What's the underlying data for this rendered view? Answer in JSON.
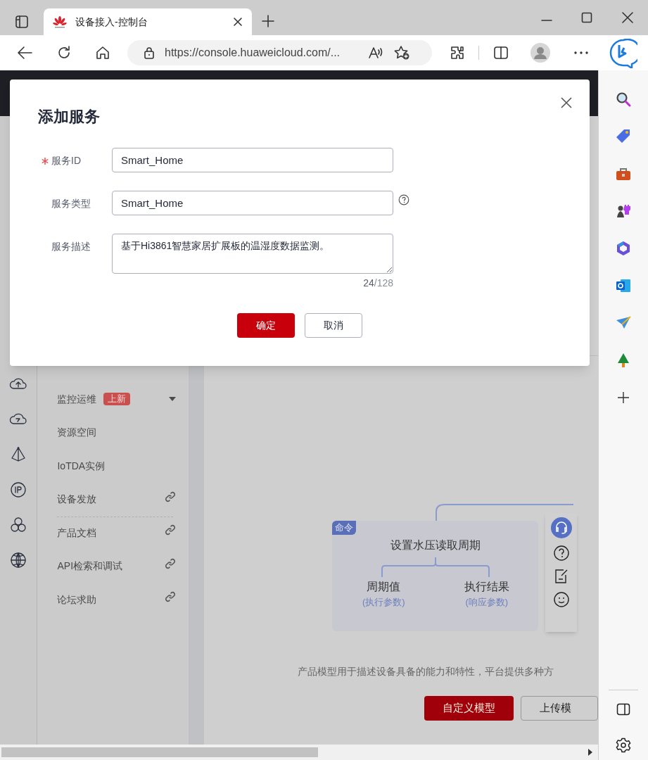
{
  "browser": {
    "tab_title": "设备接入-控制台",
    "url": "https://console.huaweicloud.com/..."
  },
  "page": {
    "nav_items": [
      {
        "label": "监控运维",
        "badge": "上新",
        "expandable": true,
        "external": false,
        "separated": false
      },
      {
        "label": "资源空间",
        "expandable": false,
        "external": false,
        "separated": false
      },
      {
        "label": "IoTDA实例",
        "expandable": false,
        "external": false,
        "separated": false
      },
      {
        "label": "设备发放",
        "expandable": false,
        "external": true,
        "separated": false
      },
      {
        "label": "产品文档",
        "expandable": false,
        "external": true,
        "separated": true
      },
      {
        "label": "API检索和调试",
        "expandable": false,
        "external": true,
        "separated": false
      },
      {
        "label": "论坛求助",
        "expandable": false,
        "external": true,
        "separated": false
      }
    ],
    "diagram": {
      "badge": "命令",
      "title": "设置水压读取周期",
      "children": [
        {
          "name": "周期值",
          "role": "(执行参数)"
        },
        {
          "name": "执行结果",
          "role": "(响应参数)"
        }
      ]
    },
    "intro_text": "产品模型用于描述设备具备的能力和特性，平台提供多种方",
    "buttons": [
      {
        "label": "自定义模型",
        "primary": true
      },
      {
        "label": "上传模",
        "primary": false
      }
    ]
  },
  "dialog": {
    "title": "添加服务",
    "fields": [
      {
        "label": "服务ID",
        "kind": "input",
        "value": "Smart_Home",
        "required": true,
        "help": false
      },
      {
        "label": "服务类型",
        "kind": "input",
        "value": "Smart_Home",
        "required": false,
        "help": true
      },
      {
        "label": "服务描述",
        "kind": "textarea",
        "value": "基于Hi3861智慧家居扩展板的温湿度数据监测。",
        "required": false,
        "help": false
      }
    ],
    "counter": {
      "current": "24",
      "limit": "/128"
    },
    "buttons": [
      {
        "label": "确定",
        "primary": true
      },
      {
        "label": "取消",
        "primary": false
      }
    ]
  }
}
